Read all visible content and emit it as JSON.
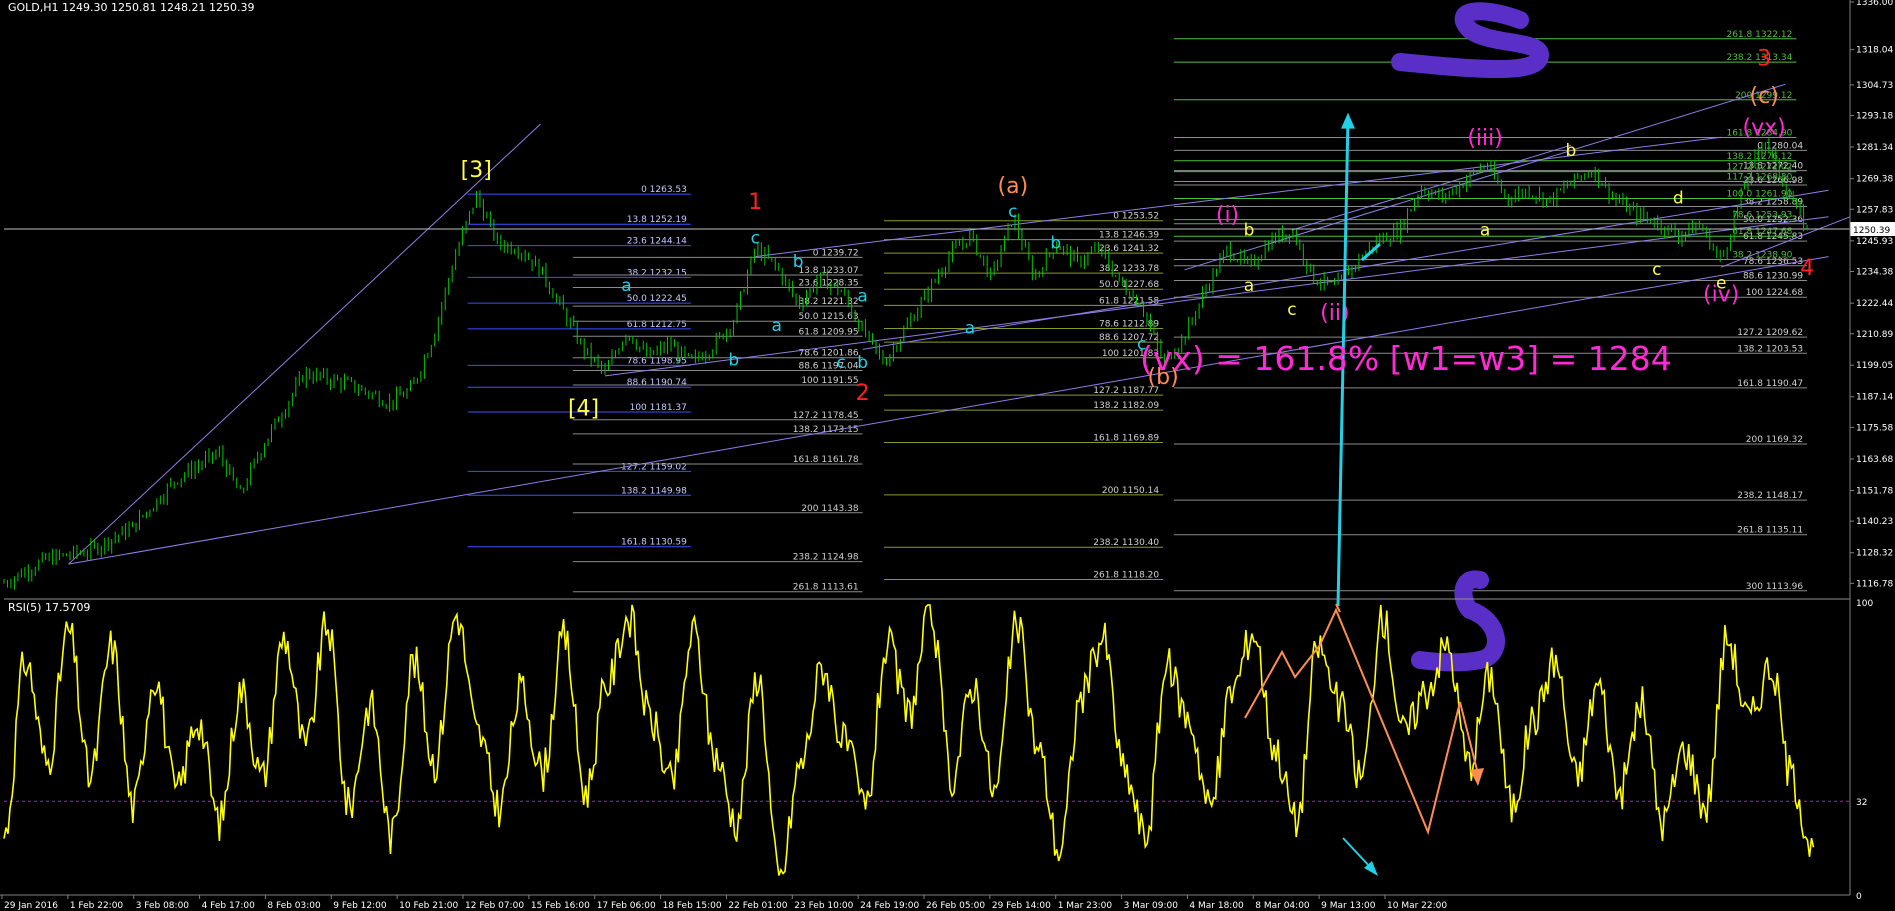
{
  "window": {
    "symbol_line": "GOLD,H1  1249.30 1250.81 1248.21 1250.39",
    "rsi_title": "RSI(5) 17.5709"
  },
  "colors": {
    "background": "#000000",
    "candles": "#00c800",
    "rsi_line": "#ffff00",
    "price_grid": "#8a8a8a",
    "fib_green": "#4fbf3a",
    "fib_blue": "#3c50ff",
    "channel": "#8f7fe6",
    "cyan": "#22d0e8",
    "orange": "#ff8c50",
    "red": "#ff2020",
    "yellow": "#ffff40",
    "magenta": "#ff2ad5",
    "purple": "#5a2fc8"
  },
  "chart_data": [
    {
      "type": "candlestick",
      "title": "GOLD,H1",
      "ohlc_last": {
        "open": 1249.3,
        "high": 1250.81,
        "low": 1248.21,
        "close": 1250.39
      },
      "current_price": "1250.39",
      "ylim": [
        1112,
        1336
      ],
      "y_ticks": [
        "1336.00",
        "1318.04",
        "1304.73",
        "1293.18",
        "1281.34",
        "1269.38",
        "1257.83",
        "1245.93",
        "1234.38",
        "1222.44",
        "1210.89",
        "1199.05",
        "1187.14",
        "1175.58",
        "1163.68",
        "1151.78",
        "1140.23",
        "1128.32",
        "1116.78"
      ],
      "x_ticks": [
        "29 Jan 2016",
        "1 Feb 22:00",
        "3 Feb 08:00",
        "4 Feb 17:00",
        "8 Feb 03:00",
        "9 Feb 12:00",
        "10 Feb 21:00",
        "12 Feb 07:00",
        "15 Feb 16:00",
        "17 Feb 06:00",
        "18 Feb 15:00",
        "22 Feb 01:00",
        "23 Feb 10:00",
        "24 Feb 19:00",
        "26 Feb 05:00",
        "29 Feb 14:00",
        "1 Mar 23:00",
        "3 Mar 09:00",
        "4 Mar 18:00",
        "8 Mar 04:00",
        "9 Mar 13:00",
        "10 Mar 22:00"
      ],
      "price_path": [
        [
          0,
          1117
        ],
        [
          2,
          1126
        ],
        [
          4,
          1129
        ],
        [
          6,
          1138
        ],
        [
          8,
          1156
        ],
        [
          10,
          1166
        ],
        [
          11,
          1150
        ],
        [
          12,
          1168
        ],
        [
          14,
          1196
        ],
        [
          16,
          1192
        ],
        [
          18,
          1185
        ],
        [
          19,
          1190
        ],
        [
          20,
          1210
        ],
        [
          21,
          1240
        ],
        [
          22,
          1263
        ],
        [
          23,
          1245
        ],
        [
          24,
          1243
        ],
        [
          25,
          1235
        ],
        [
          26,
          1220
        ],
        [
          27,
          1205
        ],
        [
          28,
          1196
        ],
        [
          29,
          1212
        ],
        [
          30,
          1202
        ],
        [
          31,
          1207
        ],
        [
          32,
          1200
        ],
        [
          33,
          1206
        ],
        [
          34,
          1216
        ],
        [
          35,
          1243
        ],
        [
          36,
          1236
        ],
        [
          37,
          1222
        ],
        [
          38,
          1232
        ],
        [
          39,
          1227
        ],
        [
          40,
          1212
        ],
        [
          41,
          1200
        ],
        [
          42,
          1213
        ],
        [
          43,
          1226
        ],
        [
          44,
          1240
        ],
        [
          45,
          1248
        ],
        [
          46,
          1232
        ],
        [
          47,
          1255
        ],
        [
          48,
          1232
        ],
        [
          49,
          1245
        ],
        [
          50,
          1238
        ],
        [
          51,
          1243
        ],
        [
          52,
          1230
        ],
        [
          53,
          1222
        ],
        [
          54,
          1200
        ],
        [
          55,
          1210
        ],
        [
          56,
          1228
        ],
        [
          57,
          1243
        ],
        [
          58,
          1236
        ],
        [
          59,
          1246
        ],
        [
          60,
          1250
        ],
        [
          61,
          1232
        ],
        [
          62,
          1228
        ],
        [
          63,
          1238
        ],
        [
          64,
          1246
        ],
        [
          65,
          1250
        ],
        [
          66,
          1266
        ],
        [
          67,
          1262
        ],
        [
          68,
          1268
        ],
        [
          69,
          1275
        ],
        [
          70,
          1262
        ],
        [
          71,
          1265
        ],
        [
          72,
          1261
        ],
        [
          73,
          1268
        ],
        [
          74,
          1273
        ],
        [
          75,
          1262
        ],
        [
          76,
          1256
        ],
        [
          77,
          1253
        ],
        [
          78,
          1248
        ],
        [
          79,
          1252
        ],
        [
          80,
          1238
        ],
        [
          81,
          1265
        ],
        [
          82,
          1285
        ],
        [
          83,
          1266
        ],
        [
          84,
          1250
        ]
      ],
      "fib_levels": [
        {
          "label": "0 1263.53",
          "price": 1263.53,
          "set": "blue"
        },
        {
          "label": "13.8 1252.19",
          "price": 1252.19,
          "set": "blue"
        },
        {
          "label": "23.6 1244.14",
          "price": 1244.14,
          "set": "blue"
        },
        {
          "label": "38.2 1232.15",
          "price": 1232.15,
          "set": "blue"
        },
        {
          "label": "50.0 1222.45",
          "price": 1222.45,
          "set": "blue"
        },
        {
          "label": "61.8 1212.75",
          "price": 1212.75,
          "set": "blue"
        },
        {
          "label": "78.6 1198.95",
          "price": 1198.95,
          "set": "blue"
        },
        {
          "label": "88.6 1190.74",
          "price": 1190.74,
          "set": "blue"
        },
        {
          "label": "100 1181.37",
          "price": 1181.37,
          "set": "blue"
        },
        {
          "label": "127.2 1159.02",
          "price": 1159.02,
          "set": "blue"
        },
        {
          "label": "138.2 1149.98",
          "price": 1149.98,
          "set": "blue"
        },
        {
          "label": "161.8 1130.59",
          "price": 1130.59,
          "set": "blue"
        },
        {
          "label": "0 1239.72",
          "price": 1239.72,
          "set": "gray"
        },
        {
          "label": "13.8 1233.07",
          "price": 1233.07,
          "set": "gray"
        },
        {
          "label": "23.6 1228.35",
          "price": 1228.35,
          "set": "gray"
        },
        {
          "label": "38.2 1221.32",
          "price": 1221.32,
          "set": "gray"
        },
        {
          "label": "50.0 1215.63",
          "price": 1215.63,
          "set": "gray"
        },
        {
          "label": "61.8 1209.95",
          "price": 1209.95,
          "set": "gray"
        },
        {
          "label": "78.6 1201.86",
          "price": 1201.86,
          "set": "gray"
        },
        {
          "label": "88.6 1197.04",
          "price": 1197.04,
          "set": "gray"
        },
        {
          "label": "100 1191.55",
          "price": 1191.55,
          "set": "gray"
        },
        {
          "label": "127.2 1178.45",
          "price": 1178.45,
          "set": "gray"
        },
        {
          "label": "138.2 1173.15",
          "price": 1173.15,
          "set": "gray"
        },
        {
          "label": "161.8 1161.78",
          "price": 1161.78,
          "set": "gray"
        },
        {
          "label": "200 1143.38",
          "price": 1143.38,
          "set": "gray"
        },
        {
          "label": "238.2 1124.98",
          "price": 1124.98,
          "set": "gray"
        },
        {
          "label": "261.8 1113.61",
          "price": 1113.61,
          "set": "gray"
        },
        {
          "label": "0 1253.52",
          "price": 1253.52,
          "set": "olive"
        },
        {
          "label": "13.8 1246.39",
          "price": 1246.39,
          "set": "olive"
        },
        {
          "label": "23.6 1241.32",
          "price": 1241.32,
          "set": "olive"
        },
        {
          "label": "38.2 1233.78",
          "price": 1233.78,
          "set": "olive"
        },
        {
          "label": "50.0 1227.68",
          "price": 1227.68,
          "set": "olive"
        },
        {
          "label": "61.8 1221.58",
          "price": 1221.58,
          "set": "olive"
        },
        {
          "label": "78.6 1212.89",
          "price": 1212.89,
          "set": "olive"
        },
        {
          "label": "88.6 1207.72",
          "price": 1207.72,
          "set": "olive"
        },
        {
          "label": "100 1201.83",
          "price": 1201.83,
          "set": "olive"
        },
        {
          "label": "127.2 1187.77",
          "price": 1187.77,
          "set": "olive"
        },
        {
          "label": "138.2 1182.09",
          "price": 1182.09,
          "set": "olive"
        },
        {
          "label": "161.8 1169.89",
          "price": 1169.89,
          "set": "olive"
        },
        {
          "label": "200 1150.14",
          "price": 1150.14,
          "set": "olive"
        },
        {
          "label": "238.2 1130.40",
          "price": 1130.4,
          "set": "olive"
        },
        {
          "label": "261.8 1118.20",
          "price": 1118.2,
          "set": "olive"
        },
        {
          "label": "0 1280.04",
          "price": 1280.04,
          "set": "gray2"
        },
        {
          "label": "13.8 1272.40",
          "price": 1272.4,
          "set": "gray2"
        },
        {
          "label": "23.6 1266.98",
          "price": 1266.98,
          "set": "gray2"
        },
        {
          "label": "38.2 1258.89",
          "price": 1258.89,
          "set": "gray2"
        },
        {
          "label": "50.0 1252.36",
          "price": 1252.36,
          "set": "gray2"
        },
        {
          "label": "61.8 1245.83",
          "price": 1245.83,
          "set": "gray2"
        },
        {
          "label": "78.6 1236.53",
          "price": 1236.53,
          "set": "gray2"
        },
        {
          "label": "88.6 1230.99",
          "price": 1230.99,
          "set": "gray2"
        },
        {
          "label": "100 1224.68",
          "price": 1224.68,
          "set": "gray2"
        },
        {
          "label": "127.2 1209.62",
          "price": 1209.62,
          "set": "gray2"
        },
        {
          "label": "138.2 1203.53",
          "price": 1203.53,
          "set": "gray2"
        },
        {
          "label": "161.8 1190.47",
          "price": 1190.47,
          "set": "gray2"
        },
        {
          "label": "200 1169.32",
          "price": 1169.32,
          "set": "gray2"
        },
        {
          "label": "238.2 1148.17",
          "price": 1148.17,
          "set": "gray2"
        },
        {
          "label": "261.8 1135.11",
          "price": 1135.11,
          "set": "gray2"
        },
        {
          "label": "300 1113.96",
          "price": 1113.96,
          "set": "gray2"
        },
        {
          "label": "261.8 1322.12",
          "price": 1322.12,
          "set": "green"
        },
        {
          "label": "238.2 1313.34",
          "price": 1313.34,
          "set": "green"
        },
        {
          "label": "200 1299.12",
          "price": 1299.12,
          "set": "green"
        },
        {
          "label": "161.8 1284.90",
          "price": 1284.9,
          "set": "green"
        },
        {
          "label": "138.2 1276.12",
          "price": 1276.12,
          "set": "green"
        },
        {
          "label": "127.2 1272.02",
          "price": 1272.02,
          "set": "green"
        },
        {
          "label": "117.2 1268.30",
          "price": 1268.3,
          "set": "green"
        },
        {
          "label": "100.0 1261.90",
          "price": 1261.9,
          "set": "green"
        },
        {
          "label": "78.6 1253.93",
          "price": 1253.93,
          "set": "green"
        },
        {
          "label": "61.8 1247.68",
          "price": 1247.68,
          "set": "green"
        },
        {
          "label": "38.2 1238.90",
          "price": 1238.9,
          "set": "green"
        }
      ],
      "wave_labels": [
        {
          "text": "[3]",
          "price": 1270,
          "t": 22,
          "color": "yellow"
        },
        {
          "text": "[4]",
          "price": 1180,
          "t": 27,
          "color": "yellow"
        },
        {
          "text": "1",
          "price": 1258,
          "t": 35,
          "color": "red"
        },
        {
          "text": "2",
          "price": 1186,
          "t": 40,
          "color": "red"
        },
        {
          "text": "3",
          "price": 1312,
          "t": 82,
          "color": "red"
        },
        {
          "text": "4",
          "price": 1233,
          "t": 84,
          "color": "red"
        },
        {
          "text": "(a)",
          "price": 1264,
          "t": 47,
          "color": "orange"
        },
        {
          "text": "(b)",
          "price": 1192,
          "t": 54,
          "color": "orange"
        },
        {
          "text": "(c)",
          "price": 1298,
          "t": 82,
          "color": "orange"
        },
        {
          "text": "(vx)",
          "price": 1286,
          "t": 82,
          "color": "magenta"
        },
        {
          "text": "(i)",
          "price": 1253,
          "t": 57,
          "color": "magenta"
        },
        {
          "text": "(ii)",
          "price": 1216,
          "t": 62,
          "color": "magenta"
        },
        {
          "text": "(iii)",
          "price": 1282,
          "t": 69,
          "color": "magenta"
        },
        {
          "text": "(iv)",
          "price": 1223,
          "t": 80,
          "color": "magenta"
        }
      ],
      "sub_labels": [
        {
          "text": "a",
          "price": 1227,
          "t": 29,
          "color": "cyan"
        },
        {
          "text": "b",
          "price": 1199,
          "t": 34,
          "color": "cyan"
        },
        {
          "text": "c",
          "price": 1245,
          "t": 35,
          "color": "cyan"
        },
        {
          "text": "b",
          "price": 1236,
          "t": 37,
          "color": "cyan"
        },
        {
          "text": "a",
          "price": 1212,
          "t": 36,
          "color": "cyan"
        },
        {
          "text": "a",
          "price": 1223,
          "t": 40,
          "color": "cyan"
        },
        {
          "text": "c",
          "price": 1198,
          "t": 39,
          "color": "cyan"
        },
        {
          "text": "b",
          "price": 1198,
          "t": 40,
          "color": "cyan"
        },
        {
          "text": "a",
          "price": 1211,
          "t": 45,
          "color": "cyan"
        },
        {
          "text": "b",
          "price": 1243,
          "t": 49,
          "color": "cyan"
        },
        {
          "text": "c",
          "price": 1255,
          "t": 47,
          "color": "cyan"
        },
        {
          "text": "c",
          "price": 1205,
          "t": 53,
          "color": "cyan"
        },
        {
          "text": "a",
          "price": 1227,
          "t": 58,
          "color": "yellow"
        },
        {
          "text": "b",
          "price": 1248,
          "t": 58,
          "color": "yellow"
        },
        {
          "text": "c",
          "price": 1218,
          "t": 60,
          "color": "yellow"
        },
        {
          "text": "a",
          "price": 1248,
          "t": 69,
          "color": "yellow"
        },
        {
          "text": "b",
          "price": 1278,
          "t": 73,
          "color": "yellow"
        },
        {
          "text": "c",
          "price": 1233,
          "t": 77,
          "color": "yellow"
        },
        {
          "text": "d",
          "price": 1260,
          "t": 78,
          "color": "yellow"
        },
        {
          "text": "e",
          "price": 1228,
          "t": 80,
          "color": "yellow"
        }
      ],
      "annotation": "(vx) = 161.8% [w1=w3] = 1284"
    },
    {
      "type": "line",
      "title": "RSI(5)",
      "current_value": "17.5709",
      "ylim": [
        0,
        100
      ],
      "y_ticks": [
        "100",
        "32",
        "0"
      ],
      "level_line": 32,
      "values": [
        20,
        80,
        45,
        90,
        40,
        85,
        30,
        75,
        35,
        60,
        25,
        70,
        40,
        88,
        50,
        92,
        30,
        65,
        20,
        80,
        45,
        96,
        55,
        30,
        70,
        42,
        88,
        35,
        72,
        95,
        60,
        38,
        90,
        48,
        25,
        75,
        5,
        45,
        78,
        52,
        30,
        85,
        62,
        96,
        40,
        72,
        35,
        92,
        50,
        15,
        68,
        88,
        42,
        20,
        78,
        60,
        30,
        70,
        90,
        50,
        25,
        85,
        65,
        40,
        95,
        55,
        70,
        85,
        45,
        75,
        30,
        60,
        80,
        40,
        72,
        35,
        65,
        25,
        50,
        30,
        88,
        60,
        78,
        40,
        15
      ]
    }
  ]
}
